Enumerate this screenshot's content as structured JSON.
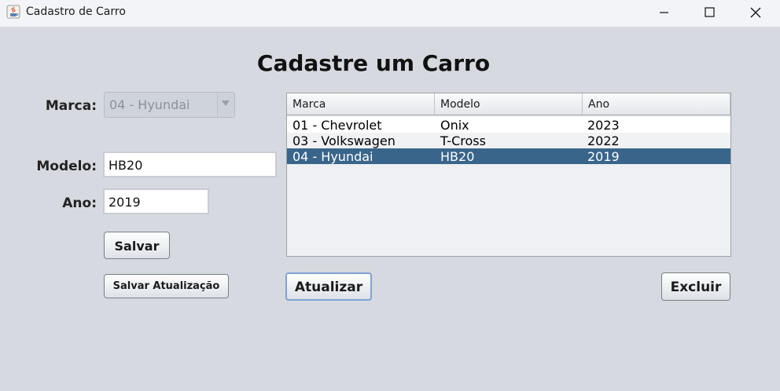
{
  "window": {
    "title": "Cadastro de Carro"
  },
  "form": {
    "heading": "Cadastre um Carro",
    "marca_label": "Marca:",
    "marca_value": "04 - Hyundai",
    "modelo_label": "Modelo:",
    "modelo_value": "HB20",
    "ano_label": "Ano:",
    "ano_value": "2019"
  },
  "buttons": {
    "salvar": "Salvar",
    "salvar_atualizacao": "Salvar Atualização",
    "atualizar": "Atualizar",
    "excluir": "Excluir"
  },
  "table": {
    "columns": [
      "Marca",
      "Modelo",
      "Ano"
    ],
    "rows": [
      [
        "01 - Chevrolet",
        "Onix",
        "2023"
      ],
      [
        "03 - Volkswagen",
        "T-Cross",
        "2022"
      ],
      [
        "04 - Hyundai",
        "HB20",
        "2019"
      ]
    ],
    "selected_row": 2
  },
  "colors": {
    "selection": "#39658b",
    "background": "#d6d9df"
  }
}
